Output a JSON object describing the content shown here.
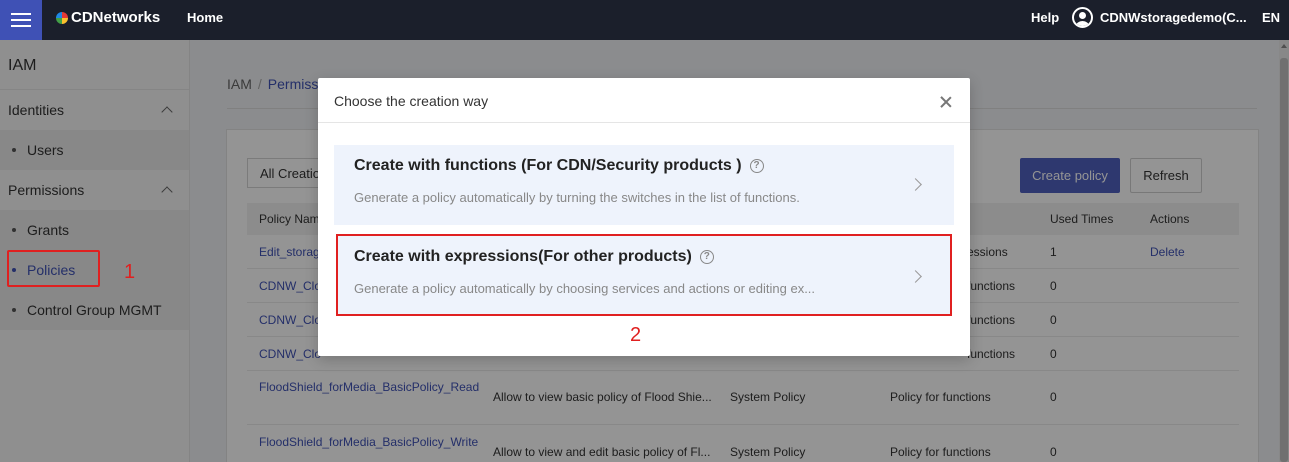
{
  "topbar": {
    "brand": "CDNetworks",
    "home": "Home",
    "help": "Help",
    "user": "CDNWstoragedemo(C...",
    "lang": "EN"
  },
  "sidebar": {
    "title": "IAM",
    "groups": [
      {
        "label": "Identities",
        "items": [
          {
            "label": "Users"
          }
        ]
      },
      {
        "label": "Permissions",
        "items": [
          {
            "label": "Grants"
          },
          {
            "label": "Policies"
          },
          {
            "label": "Control Group MGMT"
          }
        ]
      }
    ]
  },
  "breadcrumb": {
    "root": "IAM",
    "current": "Permiss"
  },
  "toolbar": {
    "filter_value": "All Creatio",
    "create_label": "Create policy",
    "refresh_label": "Refresh"
  },
  "table": {
    "headers": {
      "name": "Policy Nam",
      "used": "Used Times",
      "actions": "Actions"
    },
    "rows": [
      {
        "name": "Edit_storag",
        "desc": "",
        "type": "",
        "category": "essions",
        "used": "1",
        "action": "Delete"
      },
      {
        "name": "CDNW_Clo",
        "desc": "",
        "type": "",
        "category": "functions",
        "used": "0",
        "action": ""
      },
      {
        "name": "CDNW_Clo",
        "desc": "",
        "type": "",
        "category": "functions",
        "used": "0",
        "action": ""
      },
      {
        "name": "CDNW_Clo",
        "desc": "",
        "type": "",
        "category": "functions",
        "used": "0",
        "action": ""
      },
      {
        "name": "FloodShield_forMedia_BasicPolicy_Read",
        "desc": "Allow to view basic policy of Flood Shie...",
        "type": "System Policy",
        "category": "Policy for functions",
        "used": "0",
        "action": ""
      },
      {
        "name": "FloodShield_forMedia_BasicPolicy_Write",
        "desc": "Allow to view and edit basic policy of Fl...",
        "type": "System Policy",
        "category": "Policy for functions",
        "used": "0",
        "action": ""
      }
    ]
  },
  "modal": {
    "title": "Choose the creation way",
    "options": [
      {
        "title": "Create with functions (For CDN/Security products )",
        "desc": "Generate a policy automatically by turning the switches in the list of functions."
      },
      {
        "title": "Create with expressions(For other products)",
        "desc": "Generate a policy automatically by choosing services and actions or editing ex..."
      }
    ]
  },
  "annotations": {
    "step1": "1",
    "step2": "2"
  },
  "colors": {
    "accent": "#3f51b5",
    "annotation": "#e02020",
    "topbar": "#1b1f2b"
  },
  "icons": [
    "menu-icon",
    "brand-logo-icon",
    "user-avatar-icon",
    "chevron-up-icon",
    "close-icon",
    "help-circle-icon",
    "chevron-right-icon"
  ]
}
